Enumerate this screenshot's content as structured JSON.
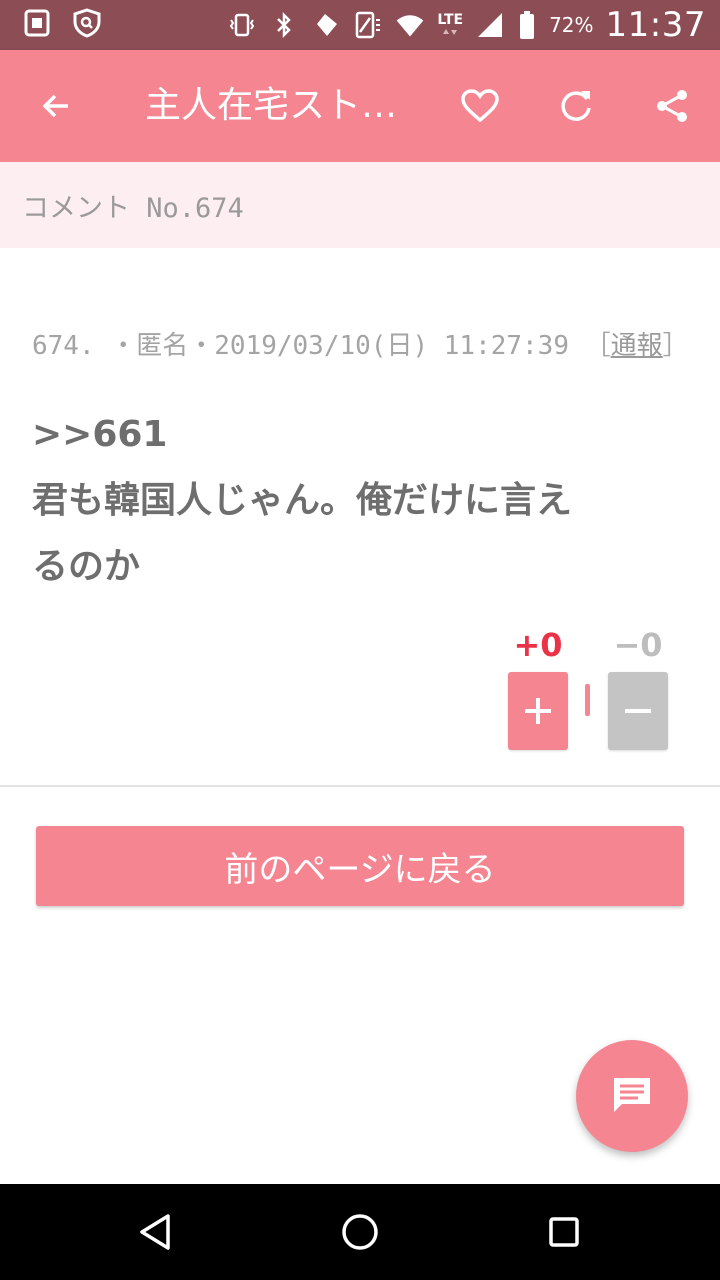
{
  "status_bar": {
    "time": "11:37",
    "battery_text": "72%",
    "network_label": "LTE",
    "icons": [
      "sim-card-icon",
      "shield-search-icon",
      "vibrate-icon",
      "bluetooth-icon",
      "nfc-icon",
      "flip-icon",
      "wifi-icon",
      "signal-icon",
      "battery-icon"
    ]
  },
  "toolbar": {
    "title": "主人在宅スト…",
    "icons": [
      "back-arrow-icon",
      "heart-icon",
      "refresh-icon",
      "share-icon"
    ]
  },
  "subheader": {
    "label": "コメント No.674"
  },
  "comment": {
    "meta_text": "674. ・匿名・2019/03/10(日) 11:27:39 ［",
    "report_label": "通報",
    "meta_end": "］",
    "reply_ref": ">>661",
    "body_line1": "君も韓国人じゃん。俺だけに言え",
    "body_line2": "るのか",
    "plus_count": "+0",
    "minus_count": "−0"
  },
  "actions": {
    "back_label": "前のページに戻る"
  },
  "fab": {
    "icon": "comment-icon"
  },
  "colors": {
    "accent": "#f48591",
    "status_bar": "#8c4d55",
    "subheader_bg": "#fdeff1",
    "plus_red": "#ea3348",
    "minus_gray": "#c4c4c4"
  }
}
